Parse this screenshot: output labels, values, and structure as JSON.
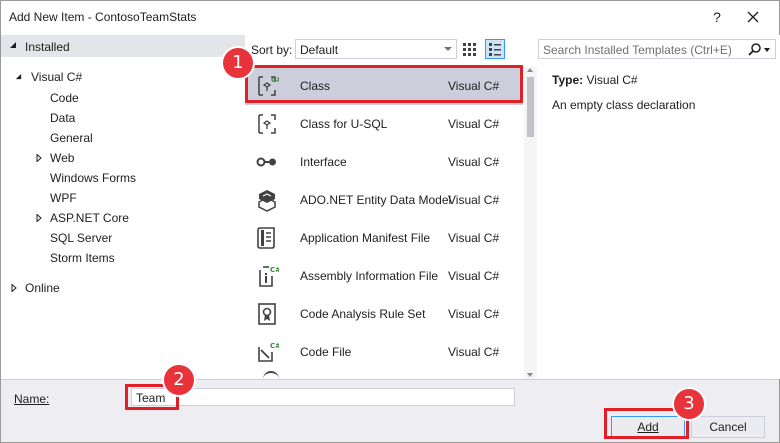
{
  "window": {
    "title": "Add New Item - ContosoTeamStats",
    "help_glyph": "?",
    "close_icon": "close-icon"
  },
  "tree": {
    "installed_label": "Installed",
    "visual_csharp_label": "Visual C#",
    "children": [
      "Code",
      "Data",
      "General",
      "Web",
      "Windows Forms",
      "WPF",
      "ASP.NET Core",
      "SQL Server",
      "Storm Items"
    ],
    "online_label": "Online"
  },
  "sortbar": {
    "label": "Sort by:",
    "selected": "Default"
  },
  "templates": [
    {
      "name": "Class",
      "lang": "Visual C#",
      "icon": "class-icon"
    },
    {
      "name": "Class for U-SQL",
      "lang": "Visual C#",
      "icon": "class-usql-icon"
    },
    {
      "name": "Interface",
      "lang": "Visual C#",
      "icon": "interface-icon"
    },
    {
      "name": "ADO.NET Entity Data Model",
      "lang": "Visual C#",
      "icon": "entity-model-icon"
    },
    {
      "name": "Application Manifest File",
      "lang": "Visual C#",
      "icon": "manifest-icon"
    },
    {
      "name": "Assembly Information File",
      "lang": "Visual C#",
      "icon": "assembly-info-icon"
    },
    {
      "name": "Code Analysis Rule Set",
      "lang": "Visual C#",
      "icon": "ruleset-icon"
    },
    {
      "name": "Code File",
      "lang": "Visual C#",
      "icon": "code-file-icon"
    }
  ],
  "details": {
    "search_placeholder": "Search Installed Templates (Ctrl+E)",
    "type_label": "Type:",
    "type_value": "Visual C#",
    "description": "An empty class declaration"
  },
  "bottom": {
    "name_label": "Name:",
    "name_value": "Team",
    "add_label": "Add",
    "cancel_label": "Cancel"
  },
  "callouts": [
    "1",
    "2",
    "3"
  ],
  "colors": {
    "highlight": "#e01f27",
    "selected_row": "#cccedb",
    "tree_header": "#e4e5ea",
    "accent": "#3399ff"
  }
}
